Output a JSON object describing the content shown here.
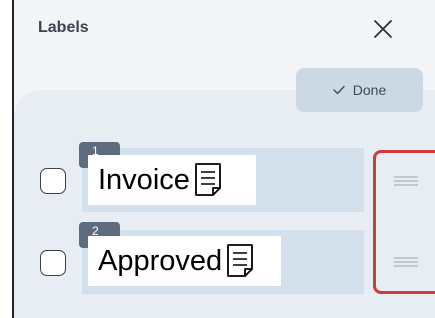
{
  "header": {
    "title": "Labels"
  },
  "toolbar": {
    "done_label": "Done"
  },
  "labels": [
    {
      "number": "1",
      "name": "Invoice"
    },
    {
      "number": "2",
      "name": "Approved"
    }
  ],
  "icons": {
    "close": "close-icon",
    "done": "checkmark-icon",
    "label": "document-icon",
    "handle": "drag-handle-icon"
  },
  "colors": {
    "highlight_border": "#d03a3a",
    "badge_bg": "#5e6c7d",
    "done_bg": "#ccd8e3"
  }
}
